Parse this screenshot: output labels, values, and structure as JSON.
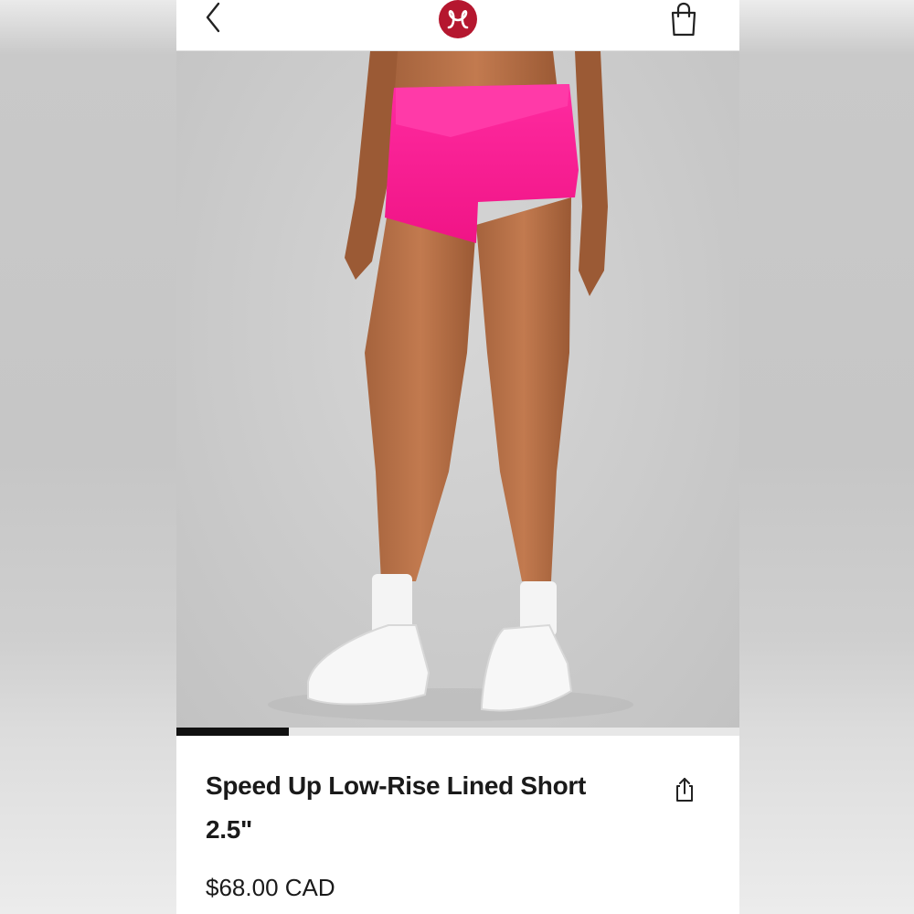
{
  "header": {
    "back_icon": "chevron-left-icon",
    "logo_icon": "lululemon-logo",
    "bag_icon": "shopping-bag-icon",
    "brand_color": "#b5172f"
  },
  "product": {
    "title": "Speed Up Low-Rise Lined Short 2.5\"",
    "price": "$68.00 CAD",
    "share_icon": "share-icon",
    "color_swatch": "#f4208e"
  },
  "gallery": {
    "image_icon": "product-photo",
    "progress": 0.2
  }
}
